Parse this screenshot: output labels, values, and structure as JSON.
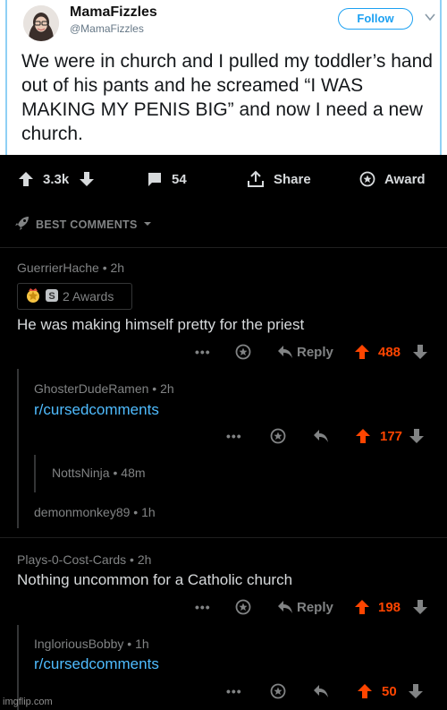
{
  "tweet": {
    "name": "MamaFizzles",
    "handle": "@MamaFizzles",
    "follow_label": "Follow",
    "text": "We were in church and I pulled my toddler’s hand out of his pants and he screamed “I WAS MAKING MY PENIS BIG” and now I need a new church."
  },
  "post_actions": {
    "score": "3.3k",
    "comments": "54",
    "share": "Share",
    "award": "Award"
  },
  "sort_label": "BEST COMMENTS",
  "comments": [
    {
      "author": "GuerrierHache",
      "time": "2h",
      "awards": "2 Awards",
      "body": "He was making himself pretty for the priest",
      "reply": "Reply",
      "score": "488"
    },
    {
      "author": "GhosterDudeRamen",
      "time": "2h",
      "body": "r/cursedcomments",
      "score": "177"
    },
    {
      "author": "NottsNinja",
      "time": "48m"
    },
    {
      "author": "demonmonkey89",
      "time": "1h"
    },
    {
      "author": "Plays-0-Cost-Cards",
      "time": "2h",
      "body": "Nothing uncommon for a Catholic church",
      "reply": "Reply",
      "score": "198"
    },
    {
      "author": "IngloriousBobby",
      "time": "1h",
      "body": "r/cursedcomments",
      "score": "50"
    }
  ],
  "dots": "•••",
  "watermark": "imgflip.com",
  "colors": {
    "upvote": "#ff4500",
    "link": "#4fbcff",
    "twitter_blue": "#1da1f2"
  }
}
